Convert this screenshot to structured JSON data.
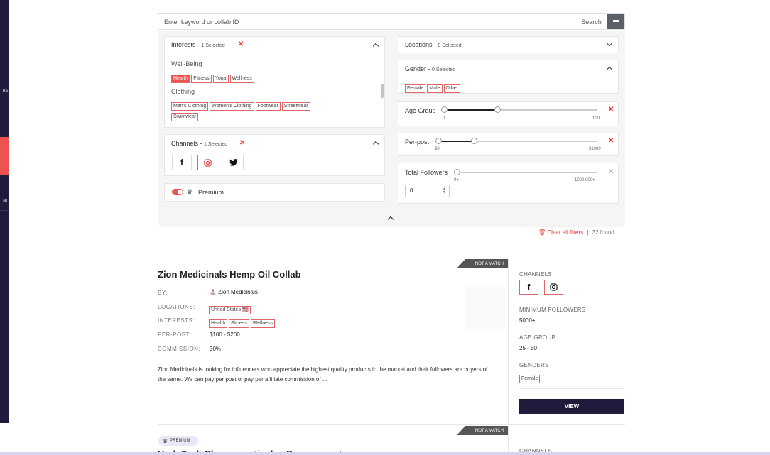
{
  "sidebar": {
    "items": [
      "RS",
      "",
      "NT"
    ]
  },
  "search": {
    "placeholder": "Enter keyword or collab ID",
    "button_label": "Search"
  },
  "filters": {
    "interests": {
      "title": "Interests - ",
      "selected": "1 Selected",
      "groups": [
        {
          "name": "Well-Being",
          "tags": [
            {
              "label": "Health",
              "selected": true
            },
            {
              "label": "Fitness",
              "selected": false
            },
            {
              "label": "Yoga",
              "selected": false
            },
            {
              "label": "Wellness",
              "selected": false
            }
          ]
        },
        {
          "name": "Clothing",
          "tags": [
            {
              "label": "Men's Clothing",
              "selected": false
            },
            {
              "label": "Women's Clothing",
              "selected": false
            },
            {
              "label": "Footwear",
              "selected": false
            },
            {
              "label": "Streetwear",
              "selected": false
            },
            {
              "label": "Swimwear",
              "selected": false
            }
          ]
        }
      ]
    },
    "channels": {
      "title": "Channels - ",
      "selected": "1 Selected",
      "icons": [
        "facebook-icon",
        "instagram-icon",
        "twitter-icon"
      ],
      "selected_channel": "instagram"
    },
    "premium": {
      "label": "Premium",
      "enabled": true
    },
    "locations": {
      "title": "Locations - ",
      "selected": "0 Selected"
    },
    "gender": {
      "title": "Gender - ",
      "selected": "0 Selected",
      "options": [
        "Female",
        "Male",
        "Other"
      ]
    },
    "age_group": {
      "title": "Age Group",
      "min_label": "0",
      "max_label": "100",
      "low": 0,
      "high": 25
    },
    "per_post": {
      "title": "Per-post",
      "min_label": "$0",
      "max_label": "$1000",
      "low": 0,
      "high": 0.23
    },
    "total_followers": {
      "title": "Total Followers",
      "min_label": "0+",
      "max_label": "1000,000+",
      "value": "0"
    }
  },
  "results": {
    "clear_label": "Clear all filters",
    "separator": "|",
    "found_label": "32 found"
  },
  "listings": [
    {
      "ribbon": "NOT A MATCH",
      "title": "Zion Medicinals Hemp Oil Collab",
      "by_label": "BY:",
      "brand": "Zion Medicinals",
      "locations_label": "LOCATIONS:",
      "location": "United States 🇺🇸",
      "interests_label": "INTERESTS:",
      "interests": [
        "Health",
        "Fitness",
        "Wellness"
      ],
      "perpost_label": "PER-POST:",
      "perpost": "$100 - $200",
      "commission_label": "COMMISSION:",
      "commission": "30%",
      "description": "Zion Medicinals is looking for influencers who appreciate the highest quality products in the market and their followers are buyers of the same. We can pay per post or pay per affiliate commission of  ...",
      "channels_label": "CHANNELS",
      "min_followers_label": "MINIMUM FOLLOWERS",
      "min_followers": "5000+",
      "age_group_label": "AGE GROUP",
      "age_group": "25 - 50",
      "genders_label": "GENDERS",
      "gender": "Female",
      "view_label": "VIEW"
    },
    {
      "ribbon": "NOT A MATCH",
      "premium_label": "PREMIUM",
      "title": "Herb Tech Pharmaceuticals - Pay per post",
      "channels_label": "CHANNELS"
    }
  ]
}
